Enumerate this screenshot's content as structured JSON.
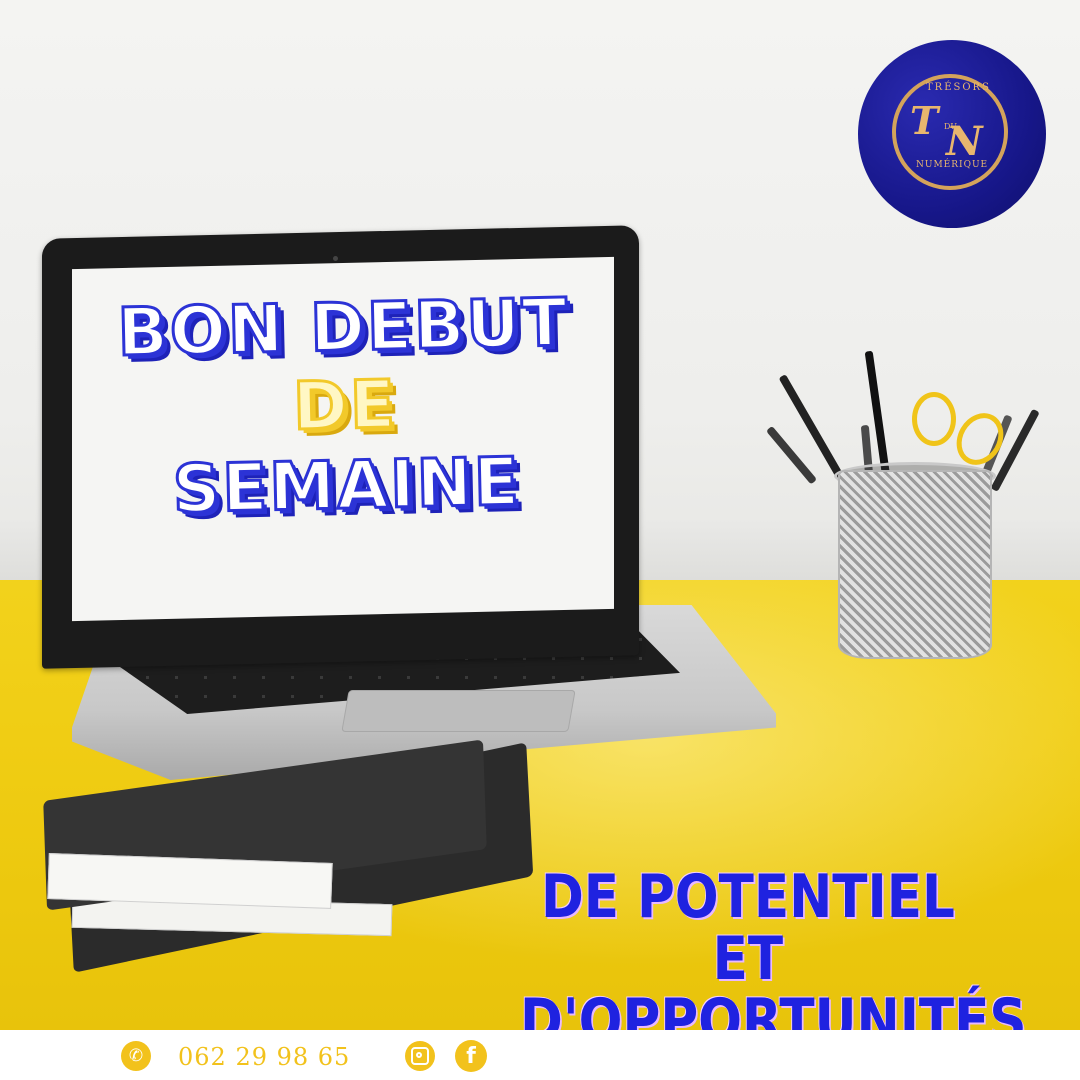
{
  "screen": {
    "line1": "BON DEBUT",
    "line2": "DE",
    "line3": "SEMAINE"
  },
  "slogan": {
    "line1": "DE POTENTIEL ET",
    "line2": "D'OPPORTUNITÉS"
  },
  "logo": {
    "top_text": "TRÉSORS",
    "middle_text": "DU",
    "bottom_text": "NUMÉRIQUE",
    "letter1": "T",
    "letter2": "N"
  },
  "footer": {
    "phone": "062 29 98 65",
    "icons": [
      "phone-icon",
      "instagram-icon",
      "facebook-icon"
    ]
  },
  "colors": {
    "accent_blue": "#1f22e0",
    "accent_yellow": "#f2c21c",
    "desk_yellow": "#f0cd14",
    "logo_bg": "#17178a",
    "logo_gold": "#d4a35b"
  }
}
